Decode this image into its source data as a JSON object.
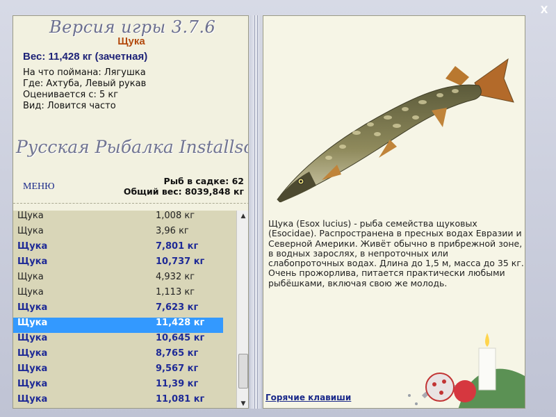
{
  "window": {
    "close_label": "X"
  },
  "header": {
    "version_text": "Версия игры   3.7.6"
  },
  "catch": {
    "fish_name": "Щука",
    "weight_text": "Вес: 11,428 кг (зачетная)",
    "details": [
      "На что поймана: Лягушка",
      "Где: Ахтуба, Левый рукав",
      "Оценивается с: 5 кг",
      "Вид: Ловится часто"
    ]
  },
  "brand": "Русская Рыбалка Installsoft",
  "menu_label": "МЕНЮ",
  "cage": {
    "count_text": "Рыб в садке: 62",
    "total_text": "Общий вес: 8039,848 кг"
  },
  "list": {
    "rows": [
      {
        "name": "Щука",
        "weight": "1,008 кг",
        "style": "normal"
      },
      {
        "name": "Щука",
        "weight": "3,96 кг",
        "style": "normal"
      },
      {
        "name": "Щука",
        "weight": "7,801 кг",
        "style": "bold"
      },
      {
        "name": "Щука",
        "weight": "10,737 кг",
        "style": "bold"
      },
      {
        "name": "Щука",
        "weight": "4,932 кг",
        "style": "normal"
      },
      {
        "name": "Щука",
        "weight": "1,113 кг",
        "style": "normal"
      },
      {
        "name": "Щука",
        "weight": "7,623 кг",
        "style": "bold"
      },
      {
        "name": "Щука",
        "weight": "11,428 кг",
        "style": "selected"
      },
      {
        "name": "Щука",
        "weight": "10,645 кг",
        "style": "bold"
      },
      {
        "name": "Щука",
        "weight": "8,765 кг",
        "style": "bold"
      },
      {
        "name": "Щука",
        "weight": "9,567 кг",
        "style": "bold"
      },
      {
        "name": "Щука",
        "weight": "11,39 кг",
        "style": "bold"
      },
      {
        "name": "Щука",
        "weight": "11,081 кг",
        "style": "bold"
      }
    ]
  },
  "description": "Щука (Esox lucius) - рыба семейства щуковых (Esocidae). Распространена в пресных водах Евразии и Северной Америки. Живёт обычно в прибрежной зоне, в водных зарослях, в непроточных или слабопроточных водах. Длина до 1,5 м, масса до 35 кг. Очень прожорлива, питается практически любыми рыбёшками, включая свою же молодь.",
  "hotkeys_label": "Горячие клавиши",
  "colors": {
    "accent_blue": "#1e2a96",
    "selection": "#3399ff",
    "fish_name": "#b34b0f"
  },
  "icons": {
    "close": "close-icon",
    "scroll_up": "scroll-up-icon",
    "scroll_down": "scroll-down-icon"
  }
}
